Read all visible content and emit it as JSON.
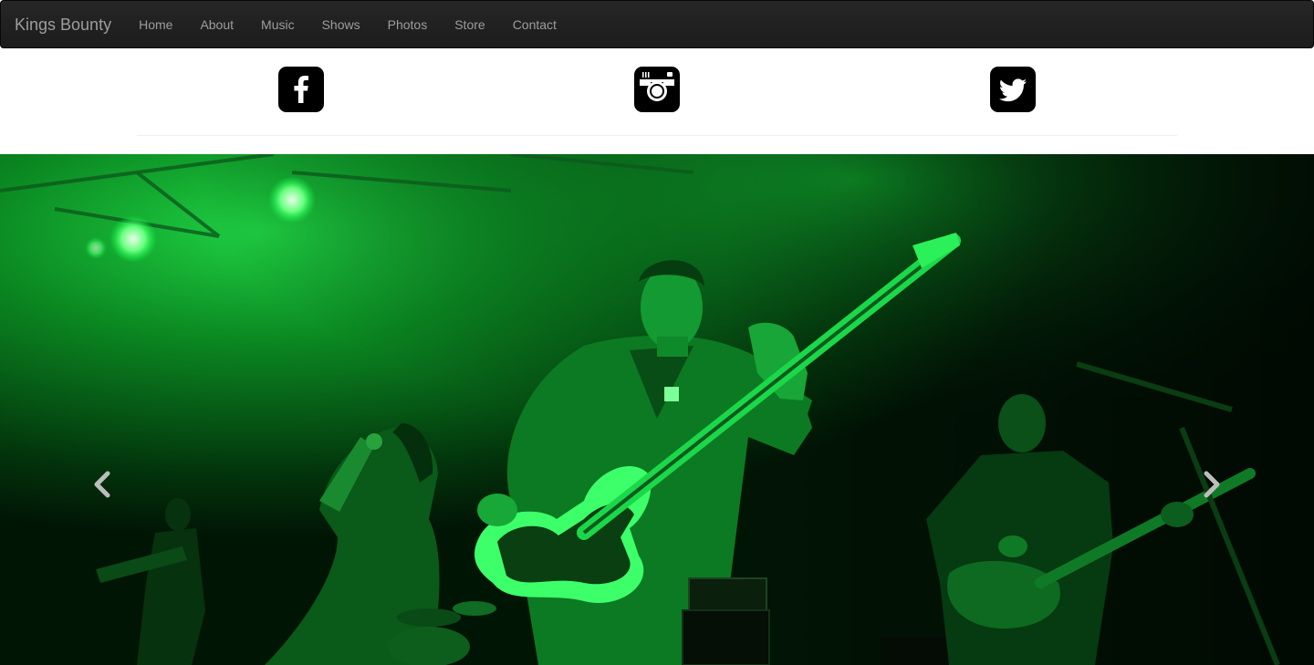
{
  "navbar": {
    "brand": "Kings Bounty",
    "items": [
      {
        "label": "Home"
      },
      {
        "label": "About"
      },
      {
        "label": "Music"
      },
      {
        "label": "Shows"
      },
      {
        "label": "Photos"
      },
      {
        "label": "Store"
      },
      {
        "label": "Contact"
      }
    ]
  },
  "social": [
    {
      "icon": "facebook-icon"
    },
    {
      "icon": "instagram-icon"
    },
    {
      "icon": "twitter-icon"
    }
  ],
  "carousel": {
    "image": "band-on-stage-green-light-photo",
    "controls": {
      "prev_icon": "chevron-left-icon",
      "next_icon": "chevron-right-icon"
    }
  },
  "colors": {
    "navbar_bg": "#222222",
    "nav_text": "#9d9d9d",
    "stage_green": "#00c832"
  }
}
